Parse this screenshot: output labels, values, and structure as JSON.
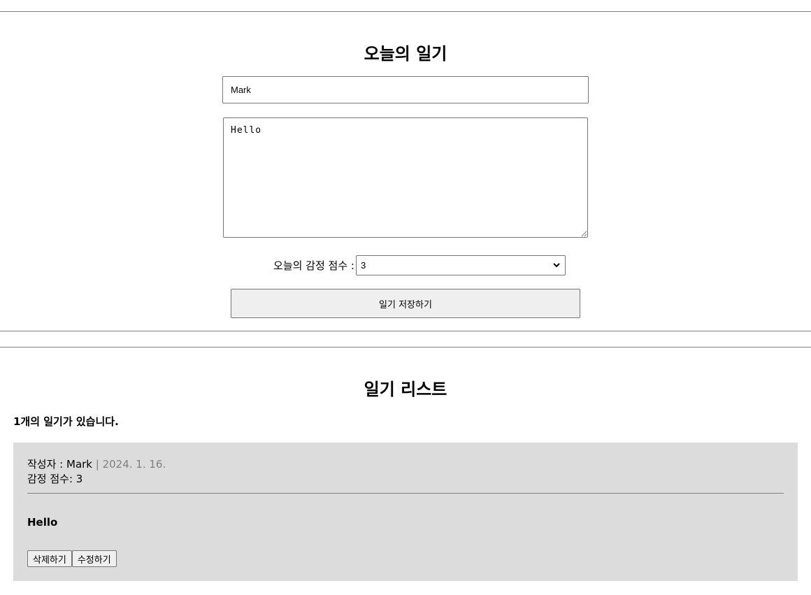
{
  "editor": {
    "title": "오늘의 일기",
    "author_value": "Mark",
    "content_value": "Hello",
    "emotion_label": "오늘의 감정 점수 :",
    "emotion_selected": "3",
    "save_label": "일기 저장하기"
  },
  "list": {
    "title": "일기 리스트",
    "count_text": "1개의 일기가 있습니다.",
    "items": [
      {
        "author_prefix": "작성자 : ",
        "author": "Mark",
        "separator": " | ",
        "date": "2024. 1. 16.",
        "emotion_prefix": "감정 점수: ",
        "emotion": "3",
        "content": "Hello",
        "delete_label": "삭제하기",
        "edit_label": "수정하기"
      }
    ]
  }
}
